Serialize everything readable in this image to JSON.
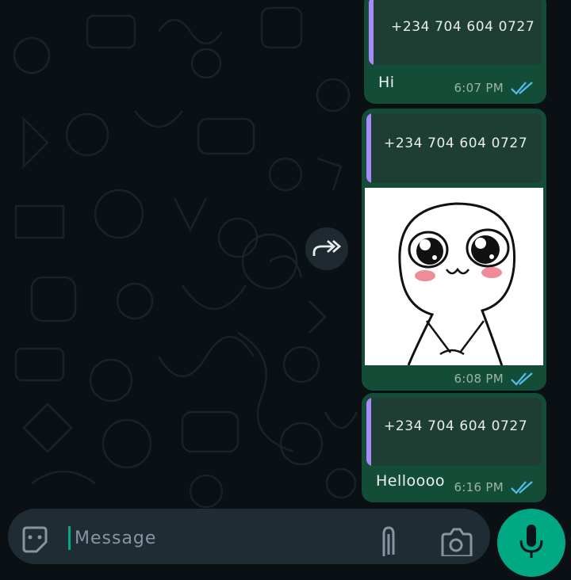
{
  "messages": [
    {
      "quoted_number": "+234 704 604 0727",
      "text": "Hi",
      "time": "6:07 PM",
      "status": "read"
    },
    {
      "quoted_number": "+234 704 604 0727",
      "text": "",
      "sticker": "cute-face-sticker",
      "time": "6:08 PM",
      "status": "read"
    },
    {
      "quoted_number": "+234 704 604 0727",
      "text": "Helloooo",
      "time": "6:16 PM",
      "status": "read"
    }
  ],
  "composer": {
    "placeholder": "Message"
  },
  "icons": {
    "forward": "forward-icon",
    "emoji": "sticker-emoji-icon",
    "attach": "paperclip-icon",
    "camera": "camera-icon",
    "mic": "mic-icon",
    "read_receipt": "double-check-icon"
  },
  "colors": {
    "background": "#0b1014",
    "outgoing_bubble": "#144d37",
    "quote_bar": "#a78bfa",
    "read_ticks": "#53bdeb",
    "accent": "#00a884",
    "composer": "#1f2c33"
  }
}
